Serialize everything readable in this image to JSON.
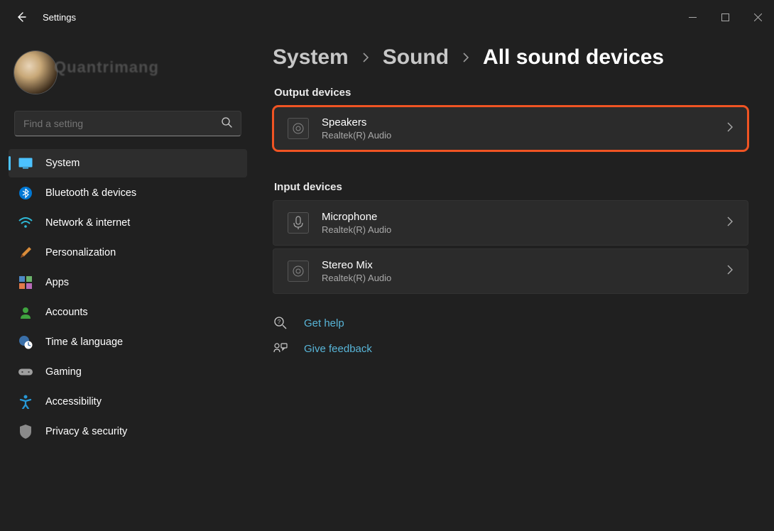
{
  "titlebar": {
    "title": "Settings"
  },
  "profile": {
    "watermark": "Quantrimang"
  },
  "search": {
    "placeholder": "Find a setting"
  },
  "nav": {
    "items": [
      {
        "label": "System"
      },
      {
        "label": "Bluetooth & devices"
      },
      {
        "label": "Network & internet"
      },
      {
        "label": "Personalization"
      },
      {
        "label": "Apps"
      },
      {
        "label": "Accounts"
      },
      {
        "label": "Time & language"
      },
      {
        "label": "Gaming"
      },
      {
        "label": "Accessibility"
      },
      {
        "label": "Privacy & security"
      }
    ]
  },
  "breadcrumb": {
    "level1": "System",
    "level2": "Sound",
    "level3": "All sound devices"
  },
  "sections": {
    "output_label": "Output devices",
    "input_label": "Input devices"
  },
  "output": [
    {
      "name": "Speakers",
      "driver": "Realtek(R) Audio"
    }
  ],
  "input": [
    {
      "name": "Microphone",
      "driver": "Realtek(R) Audio"
    },
    {
      "name": "Stereo Mix",
      "driver": "Realtek(R) Audio"
    }
  ],
  "help": {
    "get_help": "Get help",
    "feedback": "Give feedback"
  },
  "colors": {
    "accent": "#4cc2ff",
    "highlight": "#f05423",
    "link": "#58b5d8"
  }
}
